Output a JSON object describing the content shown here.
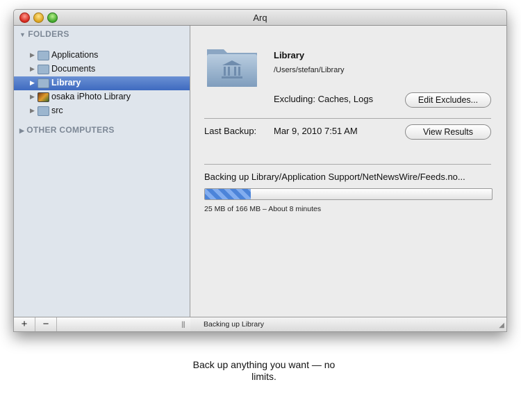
{
  "window": {
    "title": "Arq"
  },
  "sidebar": {
    "folders_header": "FOLDERS",
    "items": [
      {
        "label": "Applications",
        "icon": "applications-folder-icon"
      },
      {
        "label": "Documents",
        "icon": "documents-folder-icon"
      },
      {
        "label": "Library",
        "icon": "library-folder-icon",
        "selected": true
      },
      {
        "label": "osaka iPhoto Library",
        "icon": "iphoto-library-icon"
      },
      {
        "label": "src",
        "icon": "folder-icon"
      }
    ],
    "other_header": "OTHER COMPUTERS",
    "footer": {
      "add": "+",
      "remove": "−"
    }
  },
  "detail": {
    "name": "Library",
    "path": "/Users/stefan/Library",
    "excluding": "Excluding: Caches, Logs",
    "edit_excludes_label": "Edit Excludes...",
    "last_backup_label": "Last Backup:",
    "last_backup_value": "Mar 9, 2010 7:51 AM",
    "view_results_label": "View Results",
    "status": "Backing up Library/Application Support/NetNewsWire/Feeds.no...",
    "progress_fraction": 0.16,
    "progress_text": "25 MB of 166 MB – About 8 minutes",
    "footer_status": "Backing up Library"
  },
  "caption": "Back up anything you want — no limits.",
  "colors": {
    "selection": "#3e6ac0",
    "sidebar_bg": "#dfe5ec",
    "progress": "#4c84d9"
  }
}
